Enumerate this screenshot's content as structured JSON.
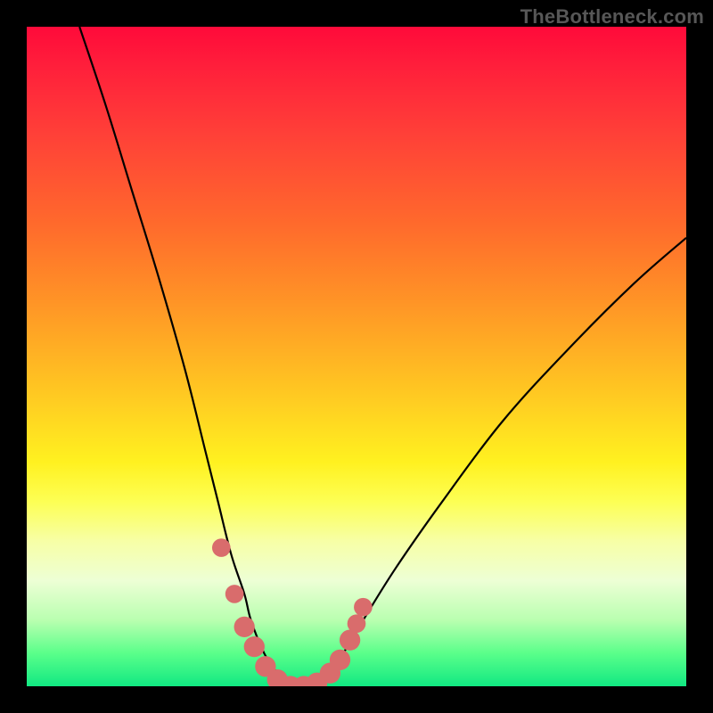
{
  "watermark": "TheBottleneck.com",
  "colors": {
    "frame": "#000000",
    "gradient_top": "#ff0a3a",
    "gradient_mid1": "#ff9526",
    "gradient_mid2": "#fff120",
    "gradient_bottom": "#11e882",
    "curve": "#000000",
    "dots": "#d96c6c"
  },
  "chart_data": {
    "type": "line",
    "title": "",
    "xlabel": "",
    "ylabel": "",
    "xlim": [
      0,
      100
    ],
    "ylim": [
      0,
      100
    ],
    "grid": false,
    "legend": false,
    "note": "V-shaped bottleneck curve; y estimated as percentage (100=top, 0=bottom) against horizontal position x (0=left, 100=right).",
    "series": [
      {
        "name": "bottleneck-curve",
        "x": [
          8,
          12,
          16,
          20,
          24,
          27,
          29,
          31,
          33,
          34,
          36,
          38,
          40,
          42,
          44,
          46,
          48,
          51,
          56,
          63,
          72,
          82,
          92,
          100
        ],
        "y": [
          100,
          88,
          75,
          62,
          48,
          36,
          28,
          20,
          14,
          10,
          5,
          2,
          0,
          0,
          0,
          2,
          5,
          10,
          18,
          28,
          40,
          51,
          61,
          68
        ]
      }
    ],
    "markers": [
      {
        "name": "dot",
        "x": 29.5,
        "y": 21,
        "r": 1.2
      },
      {
        "name": "dot",
        "x": 31.5,
        "y": 14,
        "r": 1.2
      },
      {
        "name": "dot",
        "x": 33.0,
        "y": 9,
        "r": 1.5
      },
      {
        "name": "dot",
        "x": 34.5,
        "y": 6,
        "r": 1.5
      },
      {
        "name": "dot",
        "x": 36.2,
        "y": 3,
        "r": 1.5
      },
      {
        "name": "dot",
        "x": 38.0,
        "y": 1,
        "r": 1.5
      },
      {
        "name": "dot",
        "x": 40.0,
        "y": 0,
        "r": 1.5
      },
      {
        "name": "dot",
        "x": 42.0,
        "y": 0,
        "r": 1.5
      },
      {
        "name": "dot",
        "x": 44.0,
        "y": 0.5,
        "r": 1.5
      },
      {
        "name": "dot",
        "x": 46.0,
        "y": 2,
        "r": 1.5
      },
      {
        "name": "dot",
        "x": 47.5,
        "y": 4,
        "r": 1.5
      },
      {
        "name": "dot",
        "x": 49.0,
        "y": 7,
        "r": 1.5
      },
      {
        "name": "dot",
        "x": 50.0,
        "y": 9.5,
        "r": 1.2
      },
      {
        "name": "dot",
        "x": 51.0,
        "y": 12,
        "r": 1.2
      }
    ]
  }
}
